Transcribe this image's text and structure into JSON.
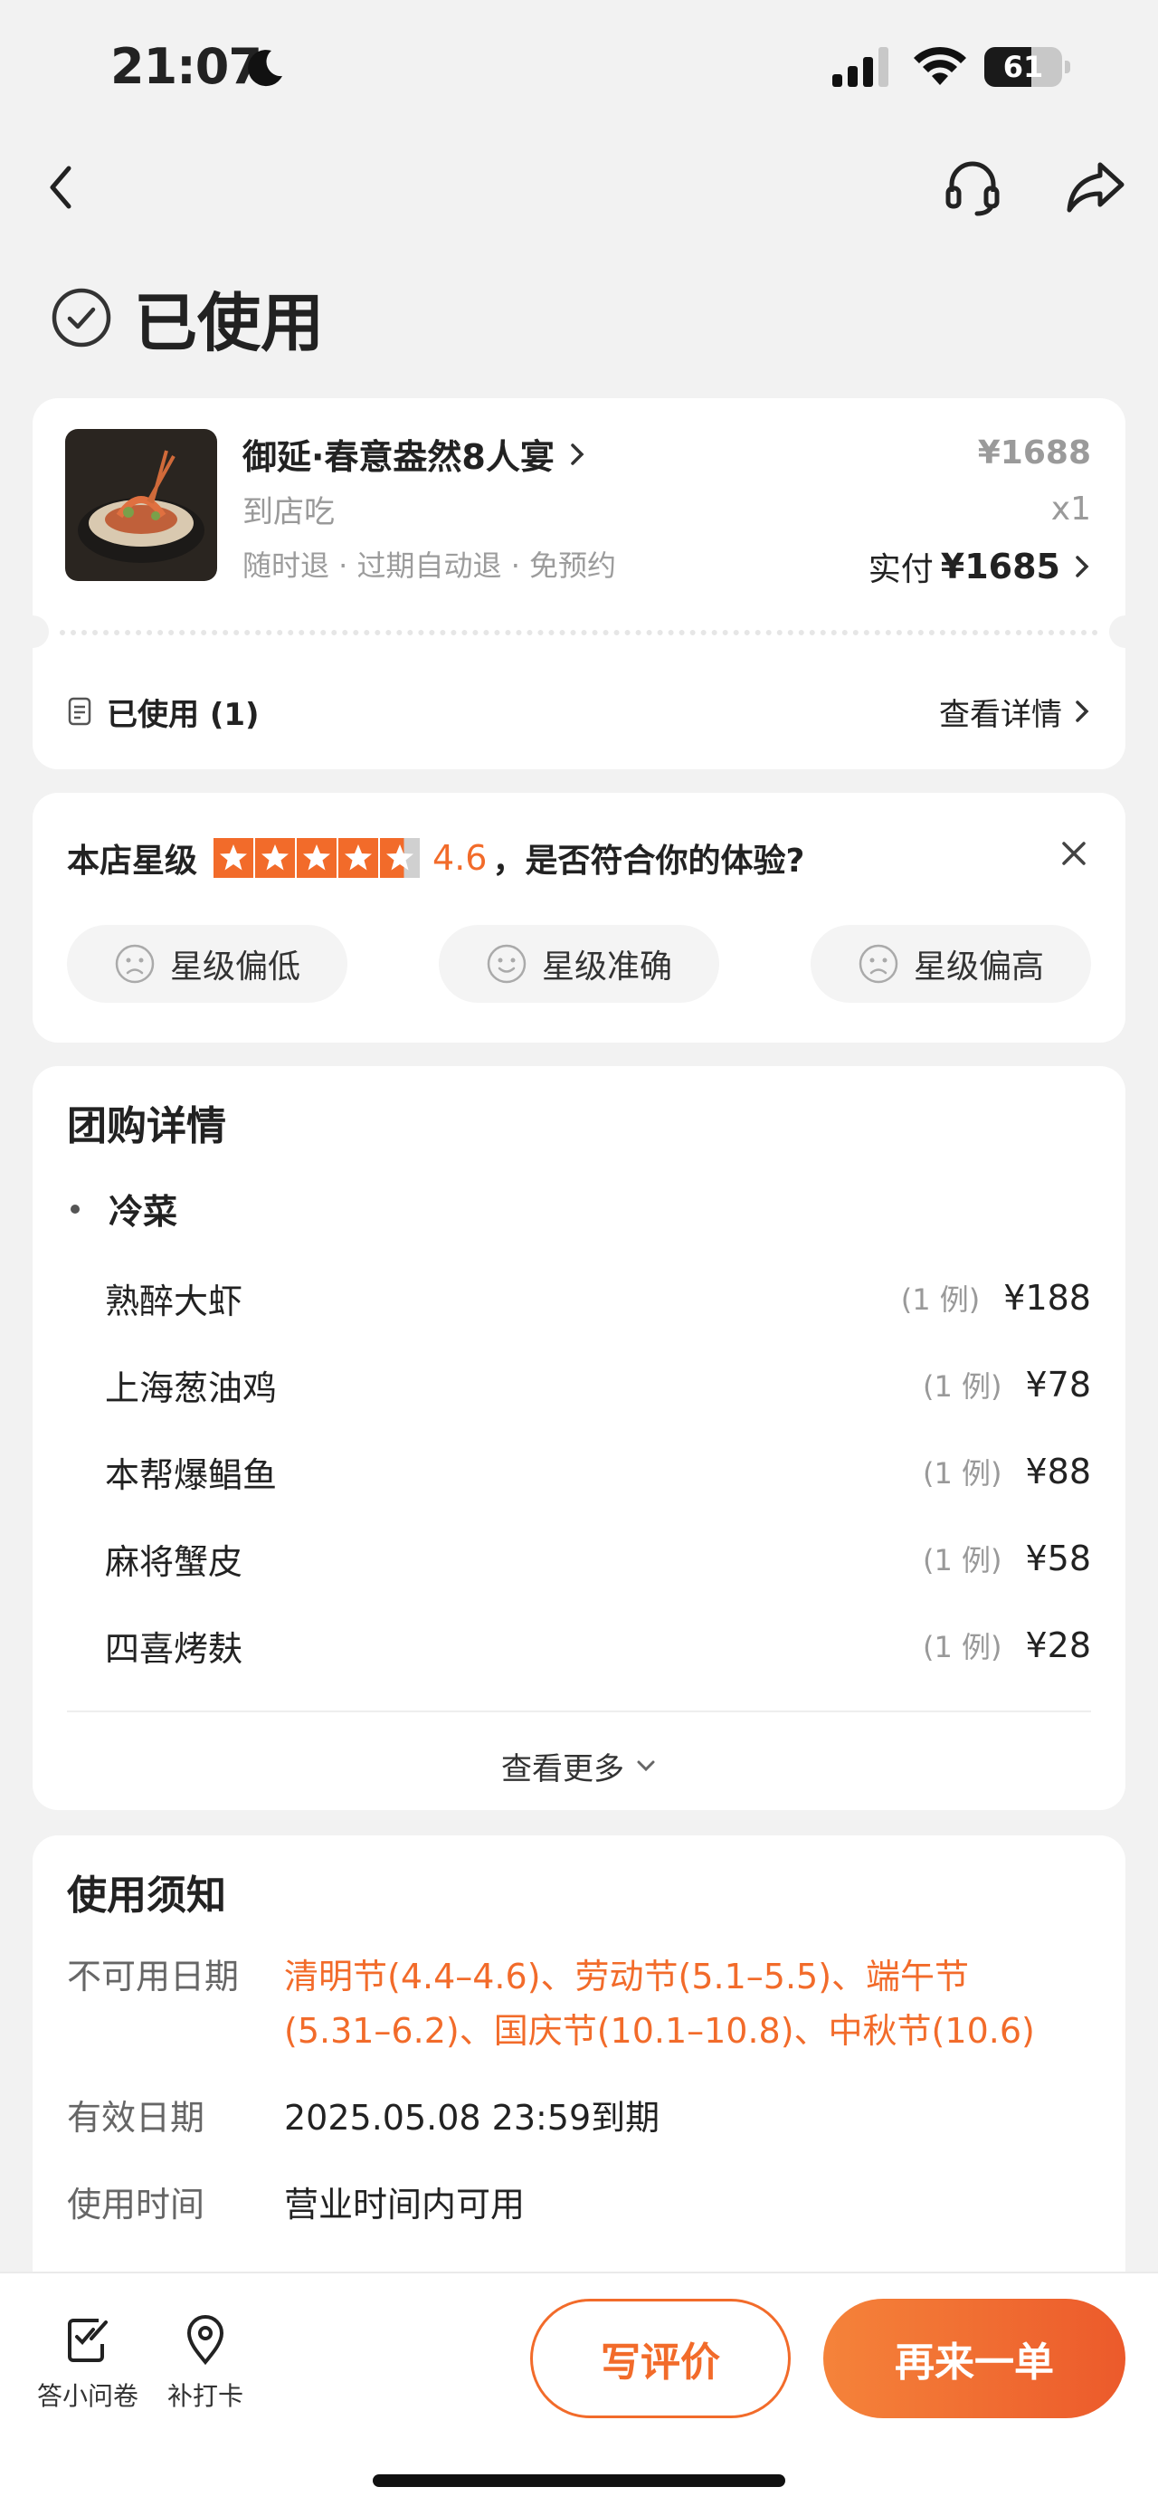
{
  "status_bar": {
    "time": "21:07",
    "battery": "61",
    "battery_level": 0.61
  },
  "order": {
    "status": "已使用",
    "deal_name": "御延·春意盎然8人宴",
    "type": "到店吃",
    "tags": "随时退 · 过期自动退 · 免预约",
    "price": "¥1688",
    "qty": "x1",
    "paid_label": "实付",
    "paid_amount": "¥1685",
    "used_label": "已使用 (1)",
    "detail_label": "查看详情"
  },
  "rating": {
    "label": "本店星级",
    "score": "4.6",
    "stars_value": 4.6,
    "question": "，是否符合你的体验?",
    "options": [
      "星级偏低",
      "星级准确",
      "星级偏高"
    ]
  },
  "group_buy": {
    "title": "团购详情",
    "category": "冷菜",
    "dishes": [
      {
        "name": "熟醉大虾",
        "count": "(1 例)",
        "price": "¥188"
      },
      {
        "name": "上海葱油鸡",
        "count": "(1 例)",
        "price": "¥78"
      },
      {
        "name": "本帮爆鲳鱼",
        "count": "(1 例)",
        "price": "¥88"
      },
      {
        "name": "麻将蟹皮",
        "count": "(1 例)",
        "price": "¥58"
      },
      {
        "name": "四喜烤麸",
        "count": "(1 例)",
        "price": "¥28"
      }
    ],
    "more": "查看更多"
  },
  "notice": {
    "title": "使用须知",
    "rows": [
      {
        "key": "不可用日期",
        "value_line1": "清明节(4.4–4.6)、劳动节(5.1–5.5)、端午节",
        "value_line2": "(5.31–6.2)、国庆节(10.1–10.8)、中秋节(10.6)"
      },
      {
        "key": "有效日期",
        "value": "2025.05.08 23:59到期"
      },
      {
        "key": "使用时间",
        "value": "营业时间内可用"
      }
    ]
  },
  "bottom": {
    "survey": "答小问卷",
    "checkin": "补打卡",
    "review": "写评价",
    "reorder": "再来一单"
  },
  "colors": {
    "accent": "#f26b2a",
    "background": "#f2f2f2"
  }
}
